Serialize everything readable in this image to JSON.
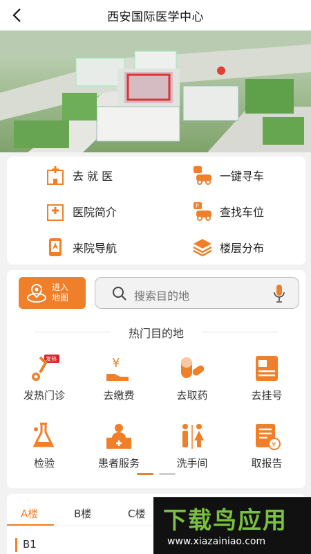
{
  "header": {
    "title": "西安国际医学中心"
  },
  "quick_links": [
    {
      "label": "去 就 医",
      "icon": "hospital-icon"
    },
    {
      "label": "一键寻车",
      "icon": "car-search-icon"
    },
    {
      "label": "医院简介",
      "icon": "hospital-info-icon"
    },
    {
      "label": "查找车位",
      "icon": "parking-icon"
    },
    {
      "label": "来院导航",
      "icon": "navigation-icon"
    },
    {
      "label": "楼层分布",
      "icon": "layers-icon"
    }
  ],
  "map_button": {
    "line1": "进入",
    "line2": "地图"
  },
  "search": {
    "placeholder": "搜索目的地"
  },
  "hot": {
    "title": "热门目的地",
    "items": [
      {
        "label": "发热门诊",
        "badge": "发热"
      },
      {
        "label": "去缴费"
      },
      {
        "label": "去取药"
      },
      {
        "label": "去挂号"
      },
      {
        "label": "检验"
      },
      {
        "label": "患者服务"
      },
      {
        "label": "洗手间"
      },
      {
        "label": "取报告"
      }
    ]
  },
  "buildings": {
    "tabs": [
      "A楼",
      "B楼",
      "C楼"
    ],
    "active": "A楼",
    "floor": "B1"
  },
  "watermark": {
    "title": "下载鸟应用",
    "url": "www.xiazainiao.com"
  },
  "colors": {
    "accent": "#f07f2a",
    "watermark_green": "#7ac143"
  }
}
